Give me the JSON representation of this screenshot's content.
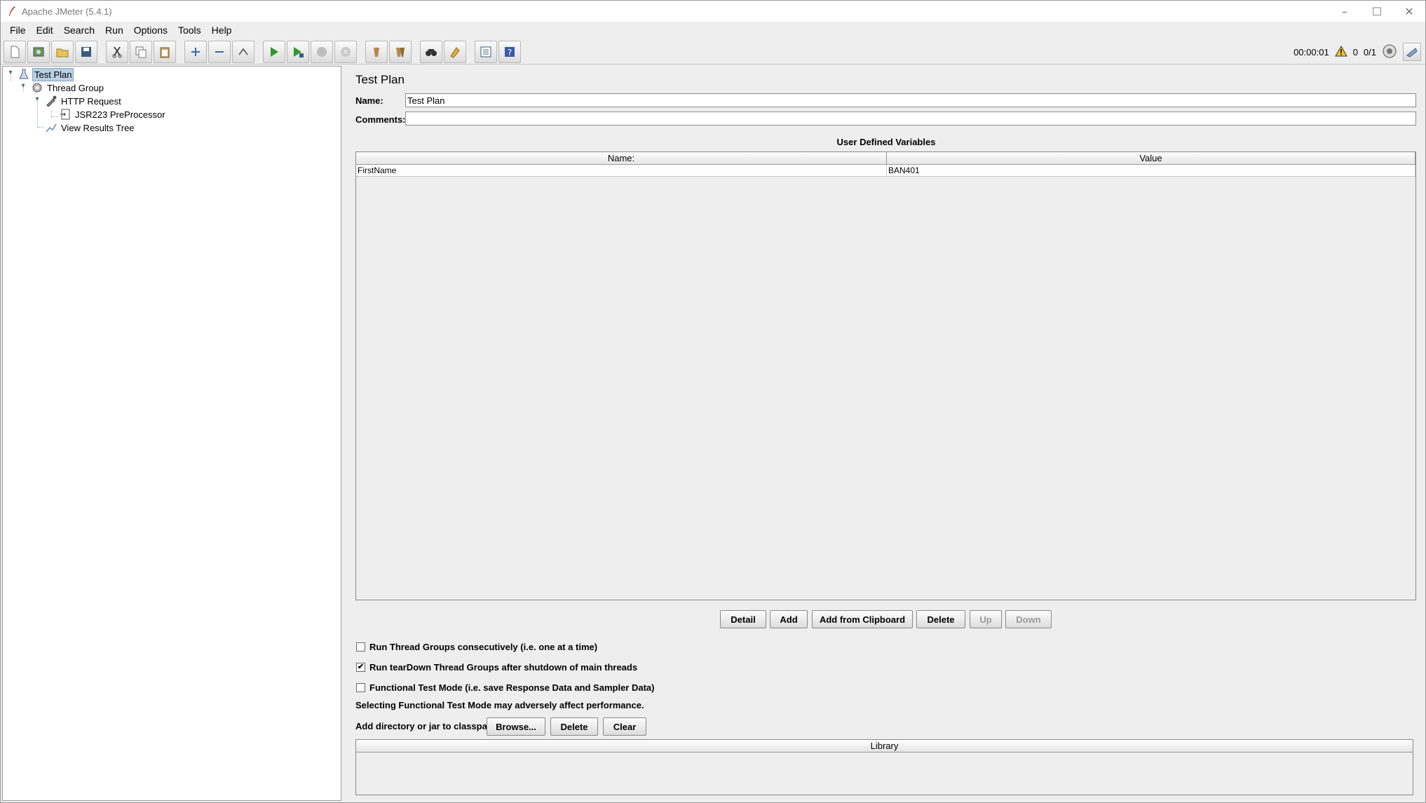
{
  "window": {
    "title": "Apache JMeter (5.4.1)"
  },
  "menu": [
    "File",
    "Edit",
    "Search",
    "Run",
    "Options",
    "Tools",
    "Help"
  ],
  "status": {
    "elapsed": "00:00:01",
    "warnings": "0",
    "threads": "0/1"
  },
  "tree": {
    "nodes": [
      {
        "label": "Test Plan",
        "icon": "test-plan-icon",
        "selected": true
      },
      {
        "label": "Thread Group",
        "icon": "gear-icon"
      },
      {
        "label": "HTTP Request",
        "icon": "pipette-icon"
      },
      {
        "label": "JSR223 PreProcessor",
        "icon": "script-icon"
      },
      {
        "label": "View Results Tree",
        "icon": "chart-icon"
      }
    ]
  },
  "panel": {
    "title": "Test Plan",
    "name_label": "Name:",
    "name_value": "Test Plan",
    "comments_label": "Comments:",
    "comments_value": "",
    "udv_title": "User Defined Variables",
    "columns": [
      "Name:",
      "Value"
    ],
    "rows": [
      {
        "name": "FirstName",
        "value": "BAN401"
      }
    ],
    "buttons": {
      "detail": "Detail",
      "add": "Add",
      "add_clipboard": "Add from Clipboard",
      "delete": "Delete",
      "up": "Up",
      "down": "Down"
    },
    "checks": [
      {
        "label": "Run Thread Groups consecutively (i.e. one at a time)",
        "checked": false
      },
      {
        "label": "Run tearDown Thread Groups after shutdown of main threads",
        "checked": true
      },
      {
        "label": "Functional Test Mode (i.e. save Response Data and Sampler Data)",
        "checked": false
      }
    ],
    "functional_note": "Selecting Functional Test Mode may adversely affect performance.",
    "classpath_label": "Add directory or jar to classpath",
    "classpath_buttons": {
      "browse": "Browse...",
      "delete": "Delete",
      "clear": "Clear"
    },
    "library_header": "Library"
  },
  "check_mark": "✔"
}
